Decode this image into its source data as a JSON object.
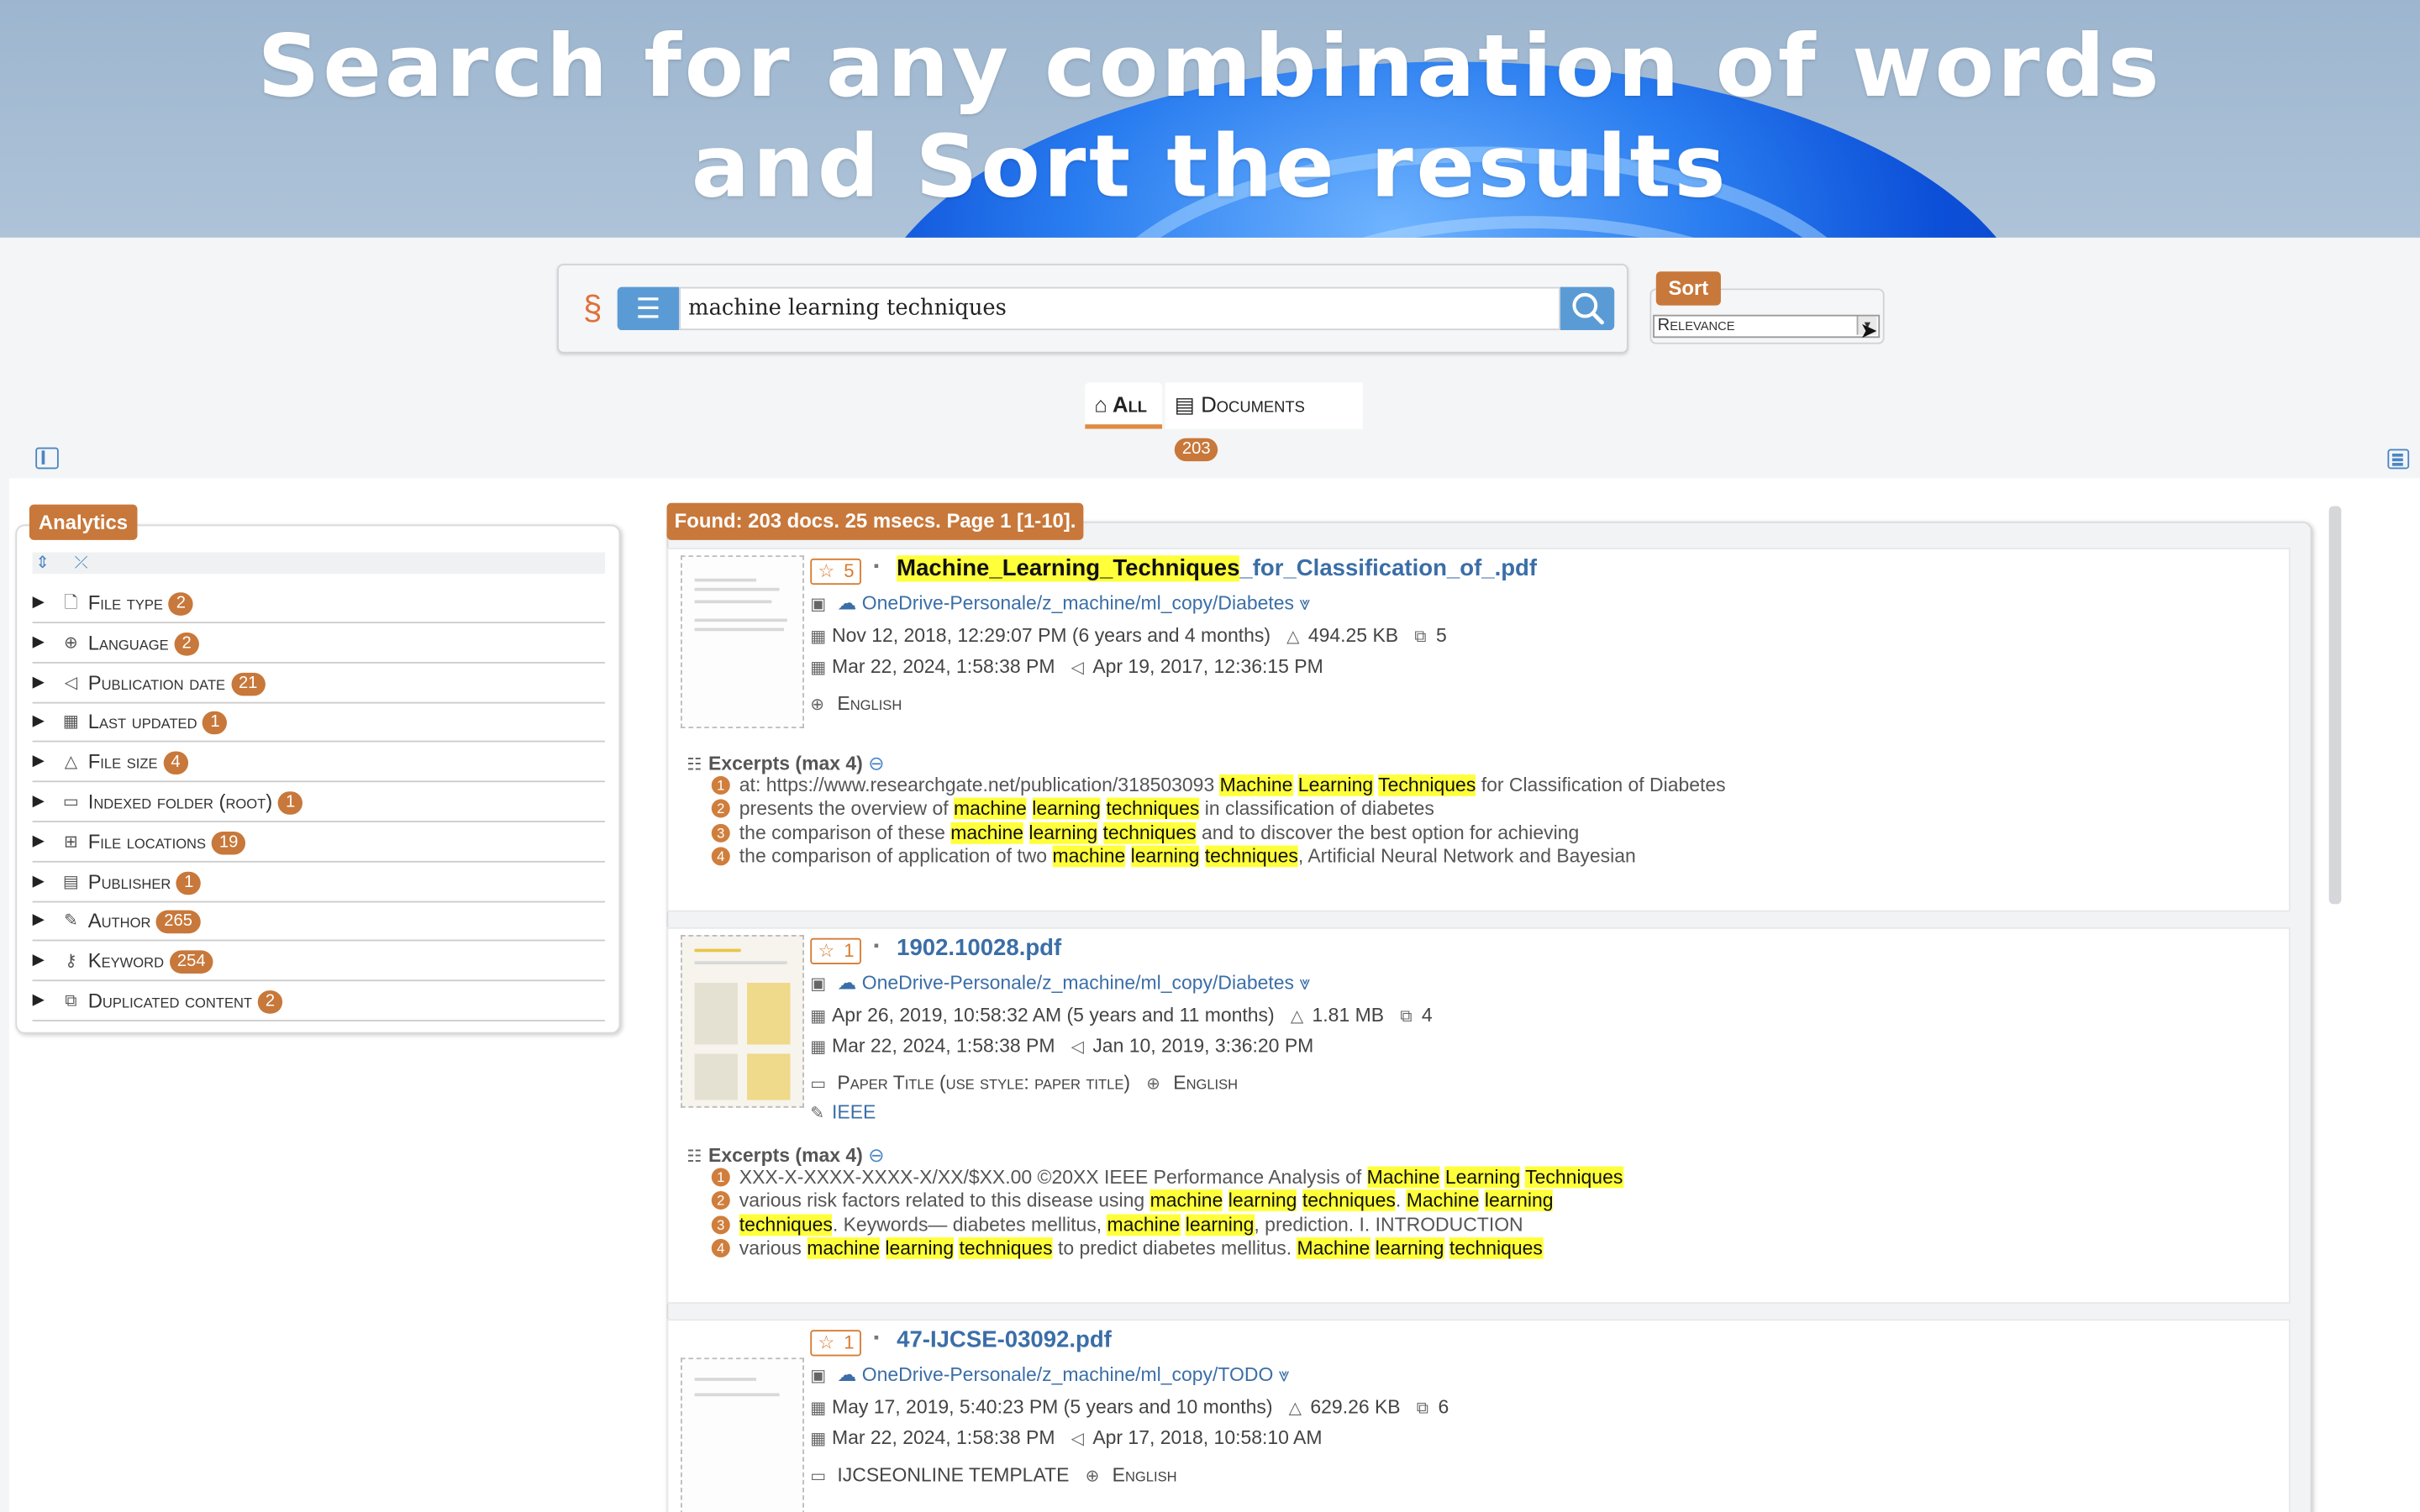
{
  "banner": {
    "line1": "Search for any combination of words",
    "line2": "and Sort the results"
  },
  "search": {
    "value": "machine learning techniques",
    "filter_icon": "sliders-icon",
    "search_icon": "magnifier-icon"
  },
  "sort": {
    "label": "Sort",
    "selected": "Relevance"
  },
  "tabs": {
    "all": "All",
    "documents": "Documents",
    "documents_count": "203"
  },
  "analytics": {
    "label": "Analytics",
    "facets": [
      {
        "label": "File type",
        "count": "2",
        "icon": "file-icon"
      },
      {
        "label": "Language",
        "count": "2",
        "icon": "globe-icon"
      },
      {
        "label": "Publication date",
        "count": "21",
        "icon": "megaphone-icon"
      },
      {
        "label": "Last updated",
        "count": "1",
        "icon": "calendar-icon"
      },
      {
        "label": "File size",
        "count": "4",
        "icon": "weight-icon"
      },
      {
        "label": "Indexed folder (root)",
        "count": "1",
        "icon": "folder-icon"
      },
      {
        "label": "File locations",
        "count": "19",
        "icon": "tree-icon"
      },
      {
        "label": "Publisher",
        "count": "1",
        "icon": "book-icon"
      },
      {
        "label": "Author",
        "count": "265",
        "icon": "pen-icon"
      },
      {
        "label": "Keyword",
        "count": "254",
        "icon": "key-icon"
      },
      {
        "label": "Duplicated content",
        "count": "2",
        "icon": "copy-icon"
      }
    ]
  },
  "found": "Found: 203 docs. 25 msecs. Page 1 [1-10].",
  "results": [
    {
      "rank": "5",
      "title_hl": "Machine_Learning_Techniques",
      "title_rest": "_for_Classification_of_.pdf",
      "path": "OneDrive-Personale/z_machine/ml_copy/Diabetes",
      "created": "Nov 12, 2018, 12:29:07 PM (6 years and 4 months)",
      "size": "494.25 KB",
      "pages": "5",
      "modified": "Mar 22, 2024, 1:58:38 PM",
      "published": "Apr 19, 2017, 12:36:15 PM",
      "language": "English",
      "excerpts_header": "Excerpts (max 4)"
    },
    {
      "rank": "1",
      "title": "1902.10028.pdf",
      "path": "OneDrive-Personale/z_machine/ml_copy/Diabetes",
      "created": "Apr 26, 2019, 10:58:32 AM (5 years and 11 months)",
      "size": "1.81 MB",
      "pages": "4",
      "modified": "Mar 22, 2024, 1:58:38 PM",
      "published": "Jan 10, 2019, 3:36:20 PM",
      "paper_title": "Paper Title (use style: paper title)",
      "language": "English",
      "publisher": "IEEE",
      "excerpts_header": "Excerpts (max 4)"
    },
    {
      "rank": "1",
      "title": "47-IJCSE-03092.pdf",
      "path": "OneDrive-Personale/z_machine/ml_copy/TODO",
      "created": "May 17, 2019, 5:40:23 PM (5 years and 10 months)",
      "size": "629.26 KB",
      "pages": "6",
      "modified": "Mar 22, 2024, 1:58:38 PM",
      "published": "Apr 17, 2018, 10:58:10 AM",
      "paper_title": "IJCSEONLINE TEMPLATE",
      "language": "English"
    }
  ],
  "ex": {
    "r0": [
      [
        "at: https://www.researchgate.net/publication/318503093 ",
        "Machine",
        " ",
        "Learning",
        " ",
        "Techniques",
        " for Classification of Diabetes"
      ],
      [
        "presents the overview of ",
        "machine",
        " ",
        "learning",
        " ",
        "techniques",
        " in classification of diabetes"
      ],
      [
        "the comparison of these ",
        "machine",
        " ",
        "learning",
        " ",
        "techniques",
        " and to discover the best option for achieving"
      ],
      [
        "the comparison of application of two ",
        "machine",
        " ",
        "learning",
        " ",
        "techniques",
        ", Artificial Neural Network and Bayesian"
      ]
    ],
    "r1": [
      [
        "XXX-X-XXXX-XXXX-X/XX/$XX.00 ©20XX IEEE Performance Analysis of ",
        "Machine",
        " ",
        "Learning",
        " ",
        "Techniques",
        ""
      ],
      [
        "various risk factors related to this disease using ",
        "machine",
        " ",
        "learning",
        " ",
        "techniques",
        ". ",
        "Machine",
        " ",
        "learning",
        ""
      ],
      [
        "",
        "techniques",
        ". Keywords— diabetes mellitus, ",
        "machine",
        " ",
        "learning",
        ", prediction. I. INTRODUCTION"
      ],
      [
        "various ",
        "machine",
        " ",
        "learning",
        " ",
        "techniques",
        " to predict diabetes mellitus. ",
        "Machine",
        " ",
        "learning",
        " ",
        "techniques",
        ""
      ]
    ]
  }
}
